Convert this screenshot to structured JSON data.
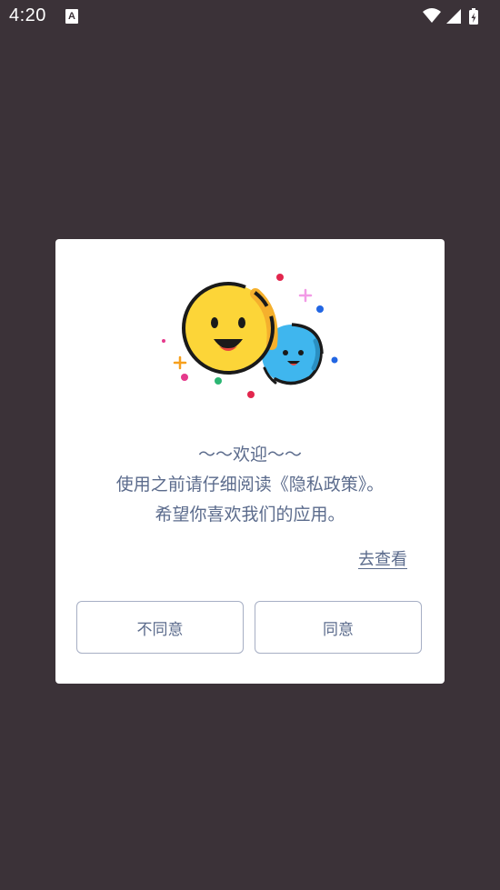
{
  "status_bar": {
    "time": "4:20",
    "notification_icon": "A",
    "icons": [
      "wifi-icon",
      "signal-icon",
      "battery-charging-icon"
    ]
  },
  "dialog": {
    "illustration": "two-smiley-faces-illustration",
    "title": "～～欢迎～～",
    "line1": "使用之前请仔细阅读《隐私政策》。",
    "line2": "希望你喜欢我们的应用。",
    "view_link": "去查看",
    "disagree_label": "不同意",
    "agree_label": "同意"
  },
  "colors": {
    "background": "#3b3238",
    "text": "#5b6b8c",
    "button_border": "#a6aec4",
    "yellow_face": "#fcd538",
    "blue_face": "#3fb6ee"
  }
}
